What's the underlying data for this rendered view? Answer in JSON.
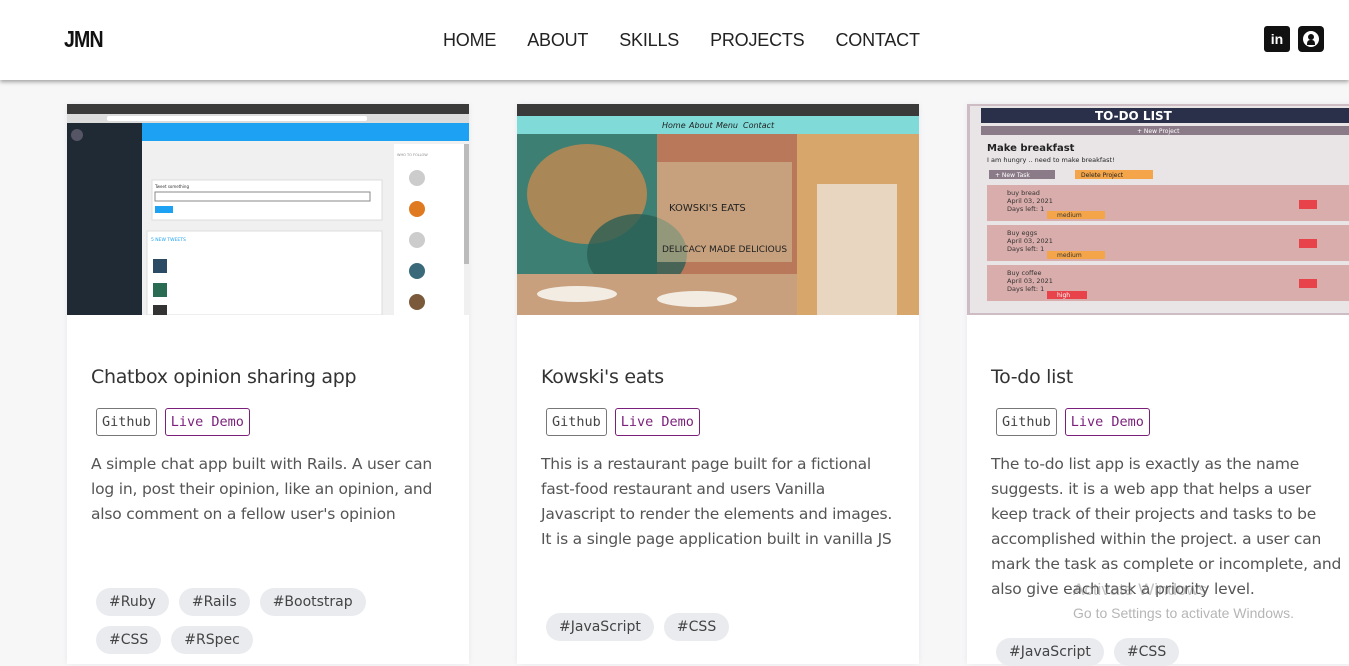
{
  "nav": {
    "logo": "JMN",
    "items": [
      "HOME",
      "ABOUT",
      "SKILLS",
      "PROJECTS",
      "CONTACT"
    ],
    "social": [
      {
        "name": "linkedin-icon",
        "glyph": "in"
      },
      {
        "name": "github-icon",
        "glyph": "◉"
      }
    ]
  },
  "projects": [
    {
      "title": "Chatbox opinion sharing app",
      "github_label": "Github",
      "demo_label": "Live Demo",
      "description": "A simple chat app built with Rails. A user can log in, post their opinion, like an opinion, and also comment on a fellow user's opinion",
      "tags": [
        "#Ruby",
        "#Rails",
        "#Bootstrap",
        "#CSS",
        "#RSpec"
      ],
      "screenshot": {
        "compose_label": "Tweet something",
        "new_tweets_label": "5 NEW TWEETS",
        "who_to_follow": "WHO TO FOLLOW",
        "nav_links": [
          "HOME",
          "PROFILE",
          "SIGN OUT"
        ],
        "sidebar_links": [
          "home",
          "profile",
          "sign out"
        ]
      }
    },
    {
      "title": "Kowski's eats",
      "github_label": "Github",
      "demo_label": "Live Demo",
      "description": "This is a restaurant page built for a fictional fast-food restaurant and users Vanilla Javascript to render the elements and images. It is a single page application built in vanilla JS",
      "tags": [
        "#JavaScript",
        "#CSS"
      ],
      "screenshot": {
        "nav_links": [
          "Home",
          "About",
          "Menu",
          "Contact"
        ],
        "brand": "KOWSKI'S EATS",
        "slogan": "DELICACY MADE DELICIOUS"
      }
    },
    {
      "title": "To-do list",
      "github_label": "Github",
      "demo_label": "Live Demo",
      "description": "The to-do list app is exactly as the name suggests. it is a web app that helps a user keep track of their projects and tasks to be accomplished within the project. a user can mark the task as complete or incomplete, and also give each task a priority level.",
      "tags": [
        "#JavaScript",
        "#CSS"
      ],
      "screenshot": {
        "header": "TO-DO LIST",
        "new_project": "+ New Project",
        "project_title": "Make breakfast",
        "project_desc": "I am hungry .. need to make breakfast!",
        "new_task": "+ New Task",
        "delete_project": "Delete Project",
        "tasks": [
          {
            "name": "buy bread",
            "date": "April 03, 2021",
            "days": "Days left: 1",
            "priority": "medium",
            "color": "#f4a54a"
          },
          {
            "name": "Buy eggs",
            "date": "April 03, 2021",
            "days": "Days left: 1",
            "priority": "medium",
            "color": "#f4a54a"
          },
          {
            "name": "Buy coffee",
            "date": "April 03, 2021",
            "days": "Days left: 1",
            "priority": "high",
            "color": "#e8424a"
          }
        ]
      }
    }
  ],
  "watermark": {
    "line1": "Activate Windows",
    "line2": "Go to Settings to activate Windows."
  }
}
